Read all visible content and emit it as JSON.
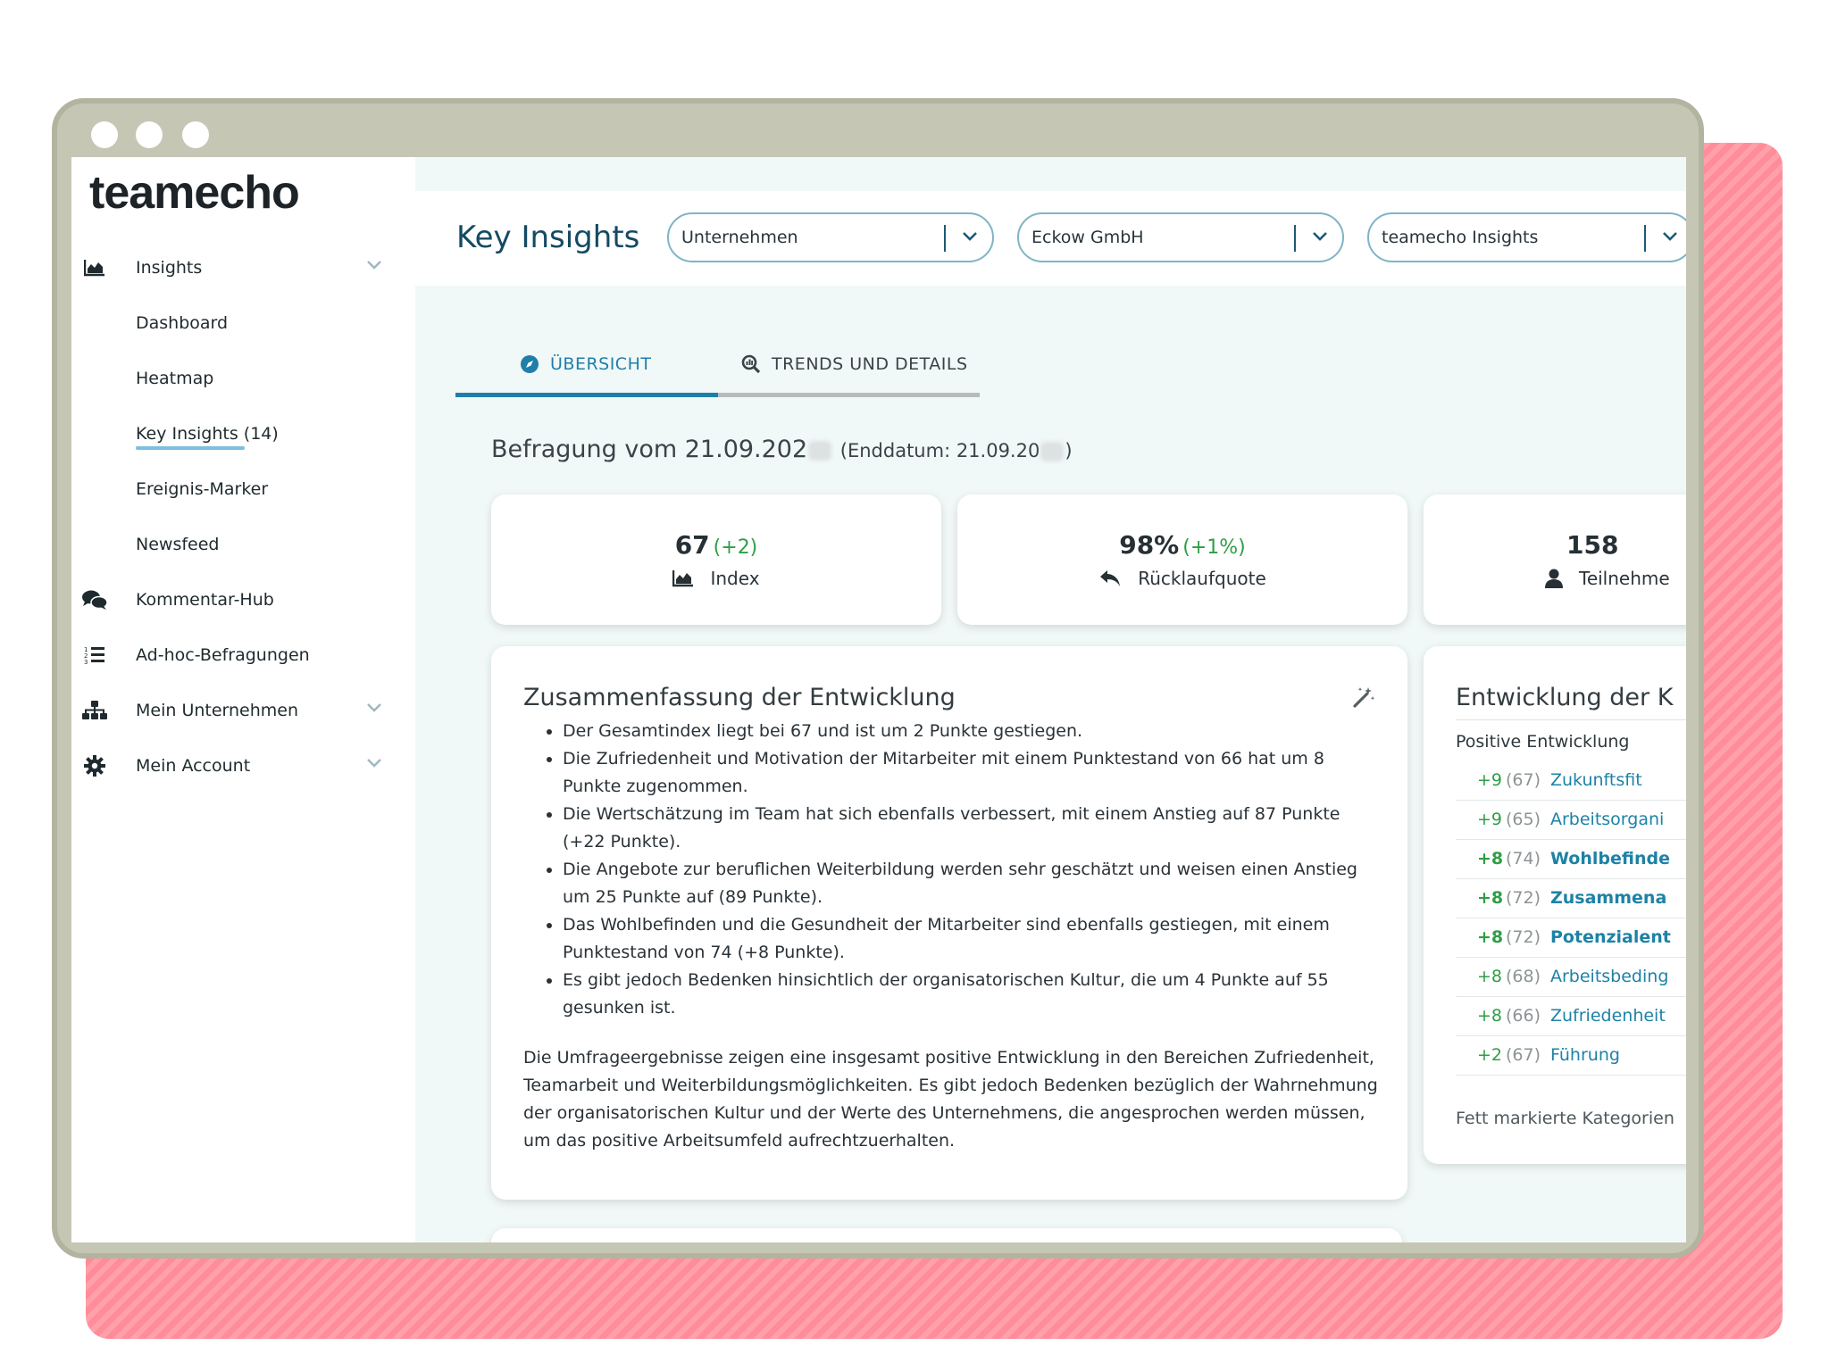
{
  "brand": {
    "logo": "teamecho"
  },
  "sidebar": {
    "items": [
      {
        "label": "Insights",
        "icon": "chart-area-icon",
        "expandable": true
      },
      {
        "label": "Dashboard"
      },
      {
        "label": "Heatmap"
      },
      {
        "label": "Key Insights (14)",
        "active": true
      },
      {
        "label": "Ereignis-Marker"
      },
      {
        "label": "Newsfeed"
      },
      {
        "label": "Kommentar-Hub",
        "icon": "comments-icon"
      },
      {
        "label": "Ad-hoc-Befragungen",
        "icon": "list-icon"
      },
      {
        "label": "Mein Unternehmen",
        "icon": "org-chart-icon",
        "expandable": true
      },
      {
        "label": "Mein Account",
        "icon": "gear-icon",
        "expandable": true
      }
    ]
  },
  "header": {
    "title": "Key Insights",
    "selects": [
      {
        "value": "Unternehmen"
      },
      {
        "value": "Eckow GmbH"
      },
      {
        "value": "teamecho Insights"
      }
    ]
  },
  "tabs": [
    {
      "label": "ÜBERSICHT",
      "icon": "compass-icon",
      "active": true
    },
    {
      "label": "TRENDS UND DETAILS",
      "icon": "search-chart-icon",
      "active": false
    }
  ],
  "survey": {
    "title_prefix": "Befragung vom 21.09.202",
    "end_prefix": "(Enddatum: 21.09.20",
    "end_suffix": ")"
  },
  "kpis": [
    {
      "value": "67",
      "delta": "(+2)",
      "label": "Index",
      "icon": "chart-area-icon"
    },
    {
      "value": "98%",
      "delta": "(+1%)",
      "label": "Rücklaufquote",
      "icon": "reply-icon"
    },
    {
      "value": "158",
      "delta": "",
      "label": "Teilnehme",
      "icon": "user-icon"
    }
  ],
  "summary": {
    "title": "Zusammenfassung der Entwicklung",
    "bullets": [
      "Der Gesamtindex liegt bei 67 und ist um 2 Punkte gestiegen.",
      "Die Zufriedenheit und Motivation der Mitarbeiter mit einem Punktestand von 66 hat um 8 Punkte zugenommen.",
      "Die Wertschätzung im Team hat sich ebenfalls verbessert, mit einem Anstieg auf 87 Punkte (+22 Punkte).",
      "Die Angebote zur beruflichen Weiterbildung werden sehr geschätzt und weisen einen Anstieg um 25 Punkte auf (89 Punkte).",
      "Das Wohlbefinden und die Gesundheit der Mitarbeiter sind ebenfalls gestiegen, mit einem Punktestand von 74 (+8 Punkte).",
      "Es gibt jedoch Bedenken hinsichtlich der organisatorischen Kultur, die um 4 Punkte auf 55 gesunken ist."
    ],
    "paragraph": "Die Umfrageergebnisse zeigen eine insgesamt positive Entwicklung in den Bereichen Zufriedenheit, Teamarbeit und Weiterbildungsmöglichkeiten. Es gibt jedoch Bedenken bezüglich der Wahrnehmung der organisatorischen Kultur und der Werte des Unternehmens, die angesprochen werden müssen, um das positive Arbeitsumfeld aufrechtzuerhalten."
  },
  "development": {
    "title": "Entwicklung der K",
    "subtitle": "Positive Entwicklung",
    "rows": [
      {
        "delta": "+9",
        "score": "(67)",
        "category": "Zukunftsfit",
        "bold": false
      },
      {
        "delta": "+9",
        "score": "(65)",
        "category": "Arbeitsorgani",
        "bold": false
      },
      {
        "delta": "+8",
        "score": "(74)",
        "category": "Wohlbefinde",
        "bold": true
      },
      {
        "delta": "+8",
        "score": "(72)",
        "category": "Zusammena",
        "bold": true
      },
      {
        "delta": "+8",
        "score": "(72)",
        "category": "Potenzialent",
        "bold": true
      },
      {
        "delta": "+8",
        "score": "(68)",
        "category": "Arbeitsbeding",
        "bold": false
      },
      {
        "delta": "+8",
        "score": "(66)",
        "category": "Zufriedenheit",
        "bold": false
      },
      {
        "delta": "+2",
        "score": "(67)",
        "category": "Führung",
        "bold": false
      }
    ],
    "footnote": "Fett markierte Kategorien"
  },
  "colors": {
    "accent": "#1f7fa8",
    "positive": "#2e9e45",
    "title": "#144a63",
    "frame": "#c5c6b4",
    "highlight": "#ff8d99"
  }
}
